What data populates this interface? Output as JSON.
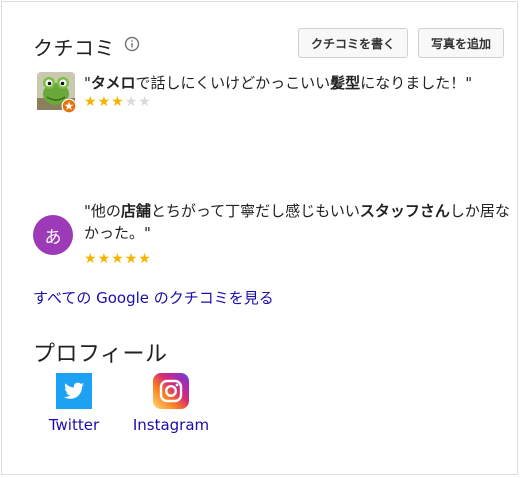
{
  "reviews_section": {
    "heading": "クチコミ",
    "write_review_label": "クチコミを書く",
    "add_photo_label": "写真を追加",
    "reviews": [
      {
        "segments": [
          {
            "t": "\"",
            "b": false
          },
          {
            "t": "タメロ",
            "b": true
          },
          {
            "t": "で話しにくいけどかっこいい",
            "b": false
          },
          {
            "t": "髪型",
            "b": true
          },
          {
            "t": "になりました！\"",
            "b": false
          }
        ],
        "rating": 3,
        "max_rating": 5
      },
      {
        "avatar_letter": "あ",
        "segments": [
          {
            "t": "\"他の",
            "b": false
          },
          {
            "t": "店舗",
            "b": true
          },
          {
            "t": "とちがって丁寧だし感じもいい",
            "b": false
          },
          {
            "t": "スタッフさん",
            "b": true
          },
          {
            "t": "しか居なかった。\"",
            "b": false
          }
        ],
        "rating": 5,
        "max_rating": 5
      }
    ],
    "all_reviews_link": "すべての Google のクチコミを見る"
  },
  "profile_section": {
    "heading": "プロフィール",
    "links": [
      {
        "label": "Twitter",
        "icon": "twitter-icon"
      },
      {
        "label": "Instagram",
        "icon": "instagram-icon"
      }
    ]
  },
  "colors": {
    "star": "#f4b400",
    "link": "#1a0dab",
    "avatar_bg": "#9c3ab7",
    "twitter": "#1da1f2"
  }
}
